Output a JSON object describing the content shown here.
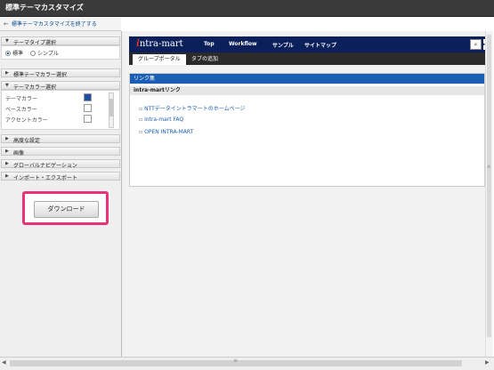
{
  "window": {
    "title": "標準テーマカスタマイズ"
  },
  "exit": {
    "label": "標準テーマカスタマイズを終了する"
  },
  "sidebar": {
    "theme_type": {
      "label": "テーマタイプ選択",
      "options": [
        "標準",
        "シンプル"
      ],
      "selected": "標準"
    },
    "standard_color_label": "標準テーマカラー選択",
    "theme_color": {
      "label": "テーマカラー選択",
      "rows": [
        {
          "label": "テーマカラー",
          "color": "#1f4fa0"
        },
        {
          "label": "ベースカラー",
          "color": "#ffffff"
        },
        {
          "label": "アクセントカラー",
          "color": "#ffffff"
        }
      ]
    },
    "sections": [
      "高度な設定",
      "画像",
      "グローバルナビゲーション",
      "インポート・エクスポート"
    ],
    "download_label": "ダウンロード",
    "highlight_color": "#e8327a"
  },
  "preview": {
    "logo": {
      "accent": "i",
      "rest": "ntra-mart"
    },
    "nav": [
      "Top",
      "Workflow",
      "サンプル",
      "サイトマップ"
    ],
    "tabs": {
      "active": "グループポータル",
      "add": "タブの追加"
    },
    "portlet": {
      "title": "リンク集",
      "subtitle": "intra-martリンク",
      "links": [
        "NTTデータイントラマートのホームページ",
        "intra-mart FAQ",
        "OPEN INTRA-MART"
      ]
    },
    "nav_color": "#0b1f5b",
    "accent_color": "#1a5fb4"
  }
}
